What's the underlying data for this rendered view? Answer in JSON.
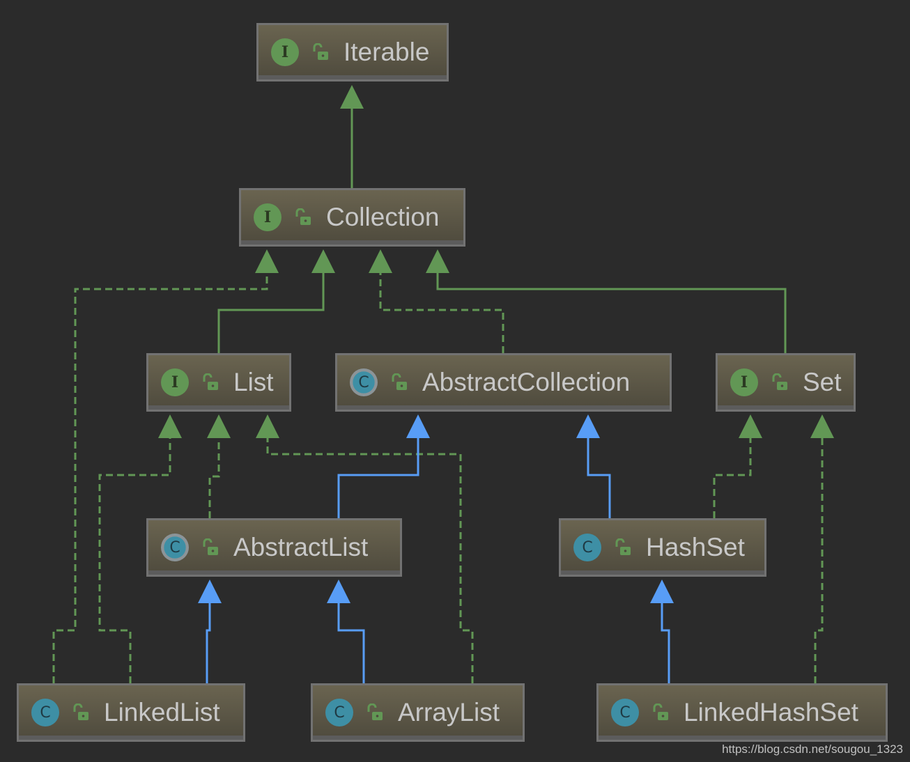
{
  "nodes": [
    {
      "id": "Iterable",
      "label": "Iterable",
      "kind": "interface",
      "badge": "I"
    },
    {
      "id": "Collection",
      "label": "Collection",
      "kind": "interface",
      "badge": "I"
    },
    {
      "id": "List",
      "label": "List",
      "kind": "interface",
      "badge": "I"
    },
    {
      "id": "AbstractCollection",
      "label": "AbstractCollection",
      "kind": "abstract",
      "badge": "C"
    },
    {
      "id": "Set",
      "label": "Set",
      "kind": "interface",
      "badge": "I"
    },
    {
      "id": "AbstractList",
      "label": "AbstractList",
      "kind": "abstract",
      "badge": "C"
    },
    {
      "id": "HashSet",
      "label": "HashSet",
      "kind": "class",
      "badge": "C"
    },
    {
      "id": "LinkedList",
      "label": "LinkedList",
      "kind": "class",
      "badge": "C"
    },
    {
      "id": "ArrayList",
      "label": "ArrayList",
      "kind": "class",
      "badge": "C"
    },
    {
      "id": "LinkedHashSet",
      "label": "LinkedHashSet",
      "kind": "class",
      "badge": "C"
    }
  ],
  "edges": [
    {
      "from": "Collection",
      "to": "Iterable",
      "type": "extends-interface"
    },
    {
      "from": "LinkedList",
      "to": "Collection",
      "type": "implements"
    },
    {
      "from": "List",
      "to": "Collection",
      "type": "extends-interface"
    },
    {
      "from": "AbstractCollection",
      "to": "Collection",
      "type": "implements"
    },
    {
      "from": "Set",
      "to": "Collection",
      "type": "extends-interface"
    },
    {
      "from": "LinkedList",
      "to": "List",
      "type": "implements"
    },
    {
      "from": "AbstractList",
      "to": "List",
      "type": "implements"
    },
    {
      "from": "ArrayList",
      "to": "List",
      "type": "implements"
    },
    {
      "from": "AbstractList",
      "to": "AbstractCollection",
      "type": "extends-class"
    },
    {
      "from": "HashSet",
      "to": "AbstractCollection",
      "type": "extends-class"
    },
    {
      "from": "HashSet",
      "to": "Set",
      "type": "implements"
    },
    {
      "from": "LinkedHashSet",
      "to": "Set",
      "type": "implements"
    },
    {
      "from": "LinkedList",
      "to": "AbstractList",
      "type": "extends-class"
    },
    {
      "from": "ArrayList",
      "to": "AbstractList",
      "type": "extends-class"
    },
    {
      "from": "LinkedHashSet",
      "to": "HashSet",
      "type": "extends-class"
    }
  ],
  "colors": {
    "interface_edge": "#629755",
    "class_edge": "#589df6",
    "background": "#2b2b2b"
  },
  "icons": {
    "visibility": "open-lock-icon"
  },
  "watermark": "https://blog.csdn.net/sougou_1323"
}
